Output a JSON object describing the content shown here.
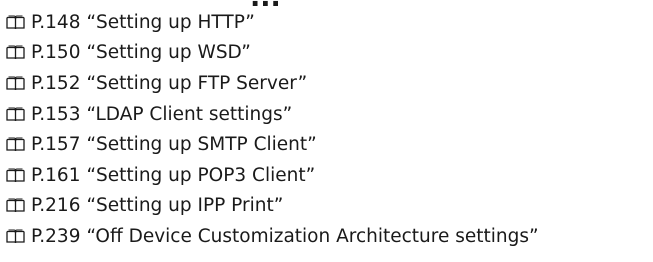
{
  "heading_fragment": "...",
  "references": [
    {
      "icon": "book-icon",
      "page": "P.148",
      "title": "“Setting up HTTP”"
    },
    {
      "icon": "book-icon",
      "page": "P.150",
      "title": "“Setting up WSD”"
    },
    {
      "icon": "book-icon",
      "page": "P.152",
      "title": "“Setting up FTP Server”"
    },
    {
      "icon": "book-icon",
      "page": "P.153",
      "title": "“LDAP Client settings”"
    },
    {
      "icon": "book-icon",
      "page": "P.157",
      "title": "“Setting up SMTP Client”"
    },
    {
      "icon": "book-icon",
      "page": "P.161",
      "title": "“Setting up POP3 Client”"
    },
    {
      "icon": "book-icon",
      "page": "P.216",
      "title": "“Setting up IPP Print”"
    },
    {
      "icon": "book-icon",
      "page": "P.239",
      "title": "“Off Device Customization Architecture settings”"
    }
  ]
}
